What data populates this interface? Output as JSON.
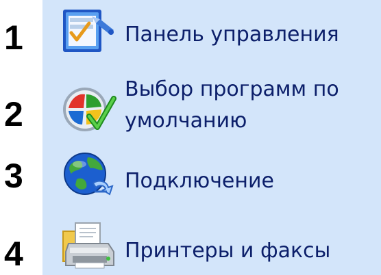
{
  "colors": {
    "panel_background": "#d3e5fa",
    "label_text": "#0c1f6a",
    "number_text": "#000000"
  },
  "menu": {
    "items": [
      {
        "number": "1",
        "label": "Панель управления",
        "icon": "control-panel-icon"
      },
      {
        "number": "2",
        "label_line1": "Выбор программ по",
        "label_line2": "умолчанию",
        "icon": "default-programs-icon"
      },
      {
        "number": "3",
        "label": "Подключение",
        "icon": "connect-to-icon"
      },
      {
        "number": "4",
        "label": "Принтеры и факсы",
        "icon": "printers-faxes-icon"
      }
    ]
  }
}
